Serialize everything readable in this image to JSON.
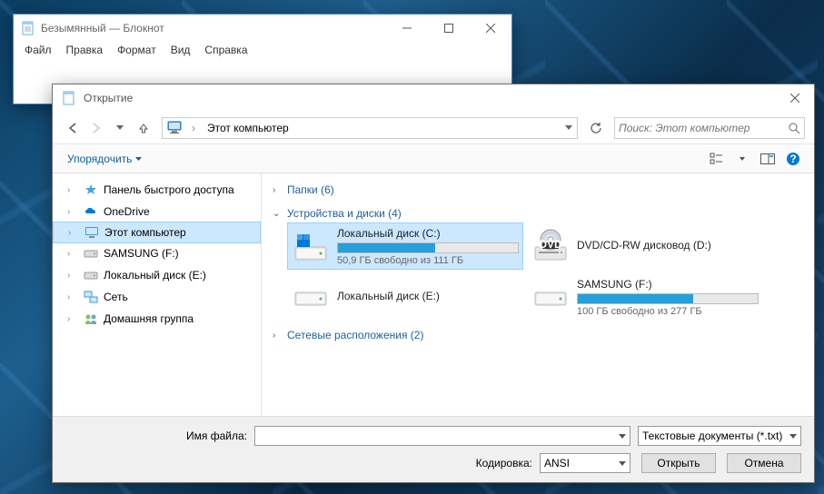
{
  "notepad": {
    "title": "Безымянный — Блокнот",
    "menu": [
      "Файл",
      "Правка",
      "Формат",
      "Вид",
      "Справка"
    ]
  },
  "dialog": {
    "title": "Открытие",
    "breadcrumb": "Этот компьютер",
    "search_placeholder": "Поиск: Этот компьютер",
    "organize": "Упорядочить",
    "tree": [
      {
        "label": "Панель быстрого доступа",
        "icon": "star",
        "exp": "›"
      },
      {
        "label": "OneDrive",
        "icon": "onedrive",
        "exp": "›"
      },
      {
        "label": "Этот компьютер",
        "icon": "pc",
        "exp": "›",
        "selected": true
      },
      {
        "label": "SAMSUNG (F:)",
        "icon": "hdd",
        "exp": "›"
      },
      {
        "label": "Локальный диск (E:)",
        "icon": "hdd",
        "exp": "›"
      },
      {
        "label": "Сеть",
        "icon": "net",
        "exp": "›"
      },
      {
        "label": "Домашняя группа",
        "icon": "homegroup",
        "exp": "›"
      }
    ],
    "groups": {
      "folders": {
        "label": "Папки (6)",
        "expanded": false
      },
      "devices": {
        "label": "Устройства и диски (4)",
        "expanded": true
      },
      "network": {
        "label": "Сетевые расположения (2)",
        "expanded": false
      }
    },
    "drives": [
      {
        "name": "Локальный диск (C:)",
        "free": "50,9 ГБ свободно из 111 ГБ",
        "pct": 54,
        "icon": "os",
        "selected": true
      },
      {
        "name": "DVD/CD-RW дисковод (D:)",
        "icon": "dvd"
      },
      {
        "name": "Локальный диск (E:)",
        "icon": "hdd-plain"
      },
      {
        "name": "SAMSUNG (F:)",
        "free": "100 ГБ свободно из 277 ГБ",
        "pct": 64,
        "icon": "hdd-plain"
      }
    ],
    "filename_label": "Имя файла:",
    "filter": "Текстовые документы (*.txt)",
    "encoding_label": "Кодировка:",
    "encoding": "ANSI",
    "open": "Открыть",
    "cancel": "Отмена"
  }
}
